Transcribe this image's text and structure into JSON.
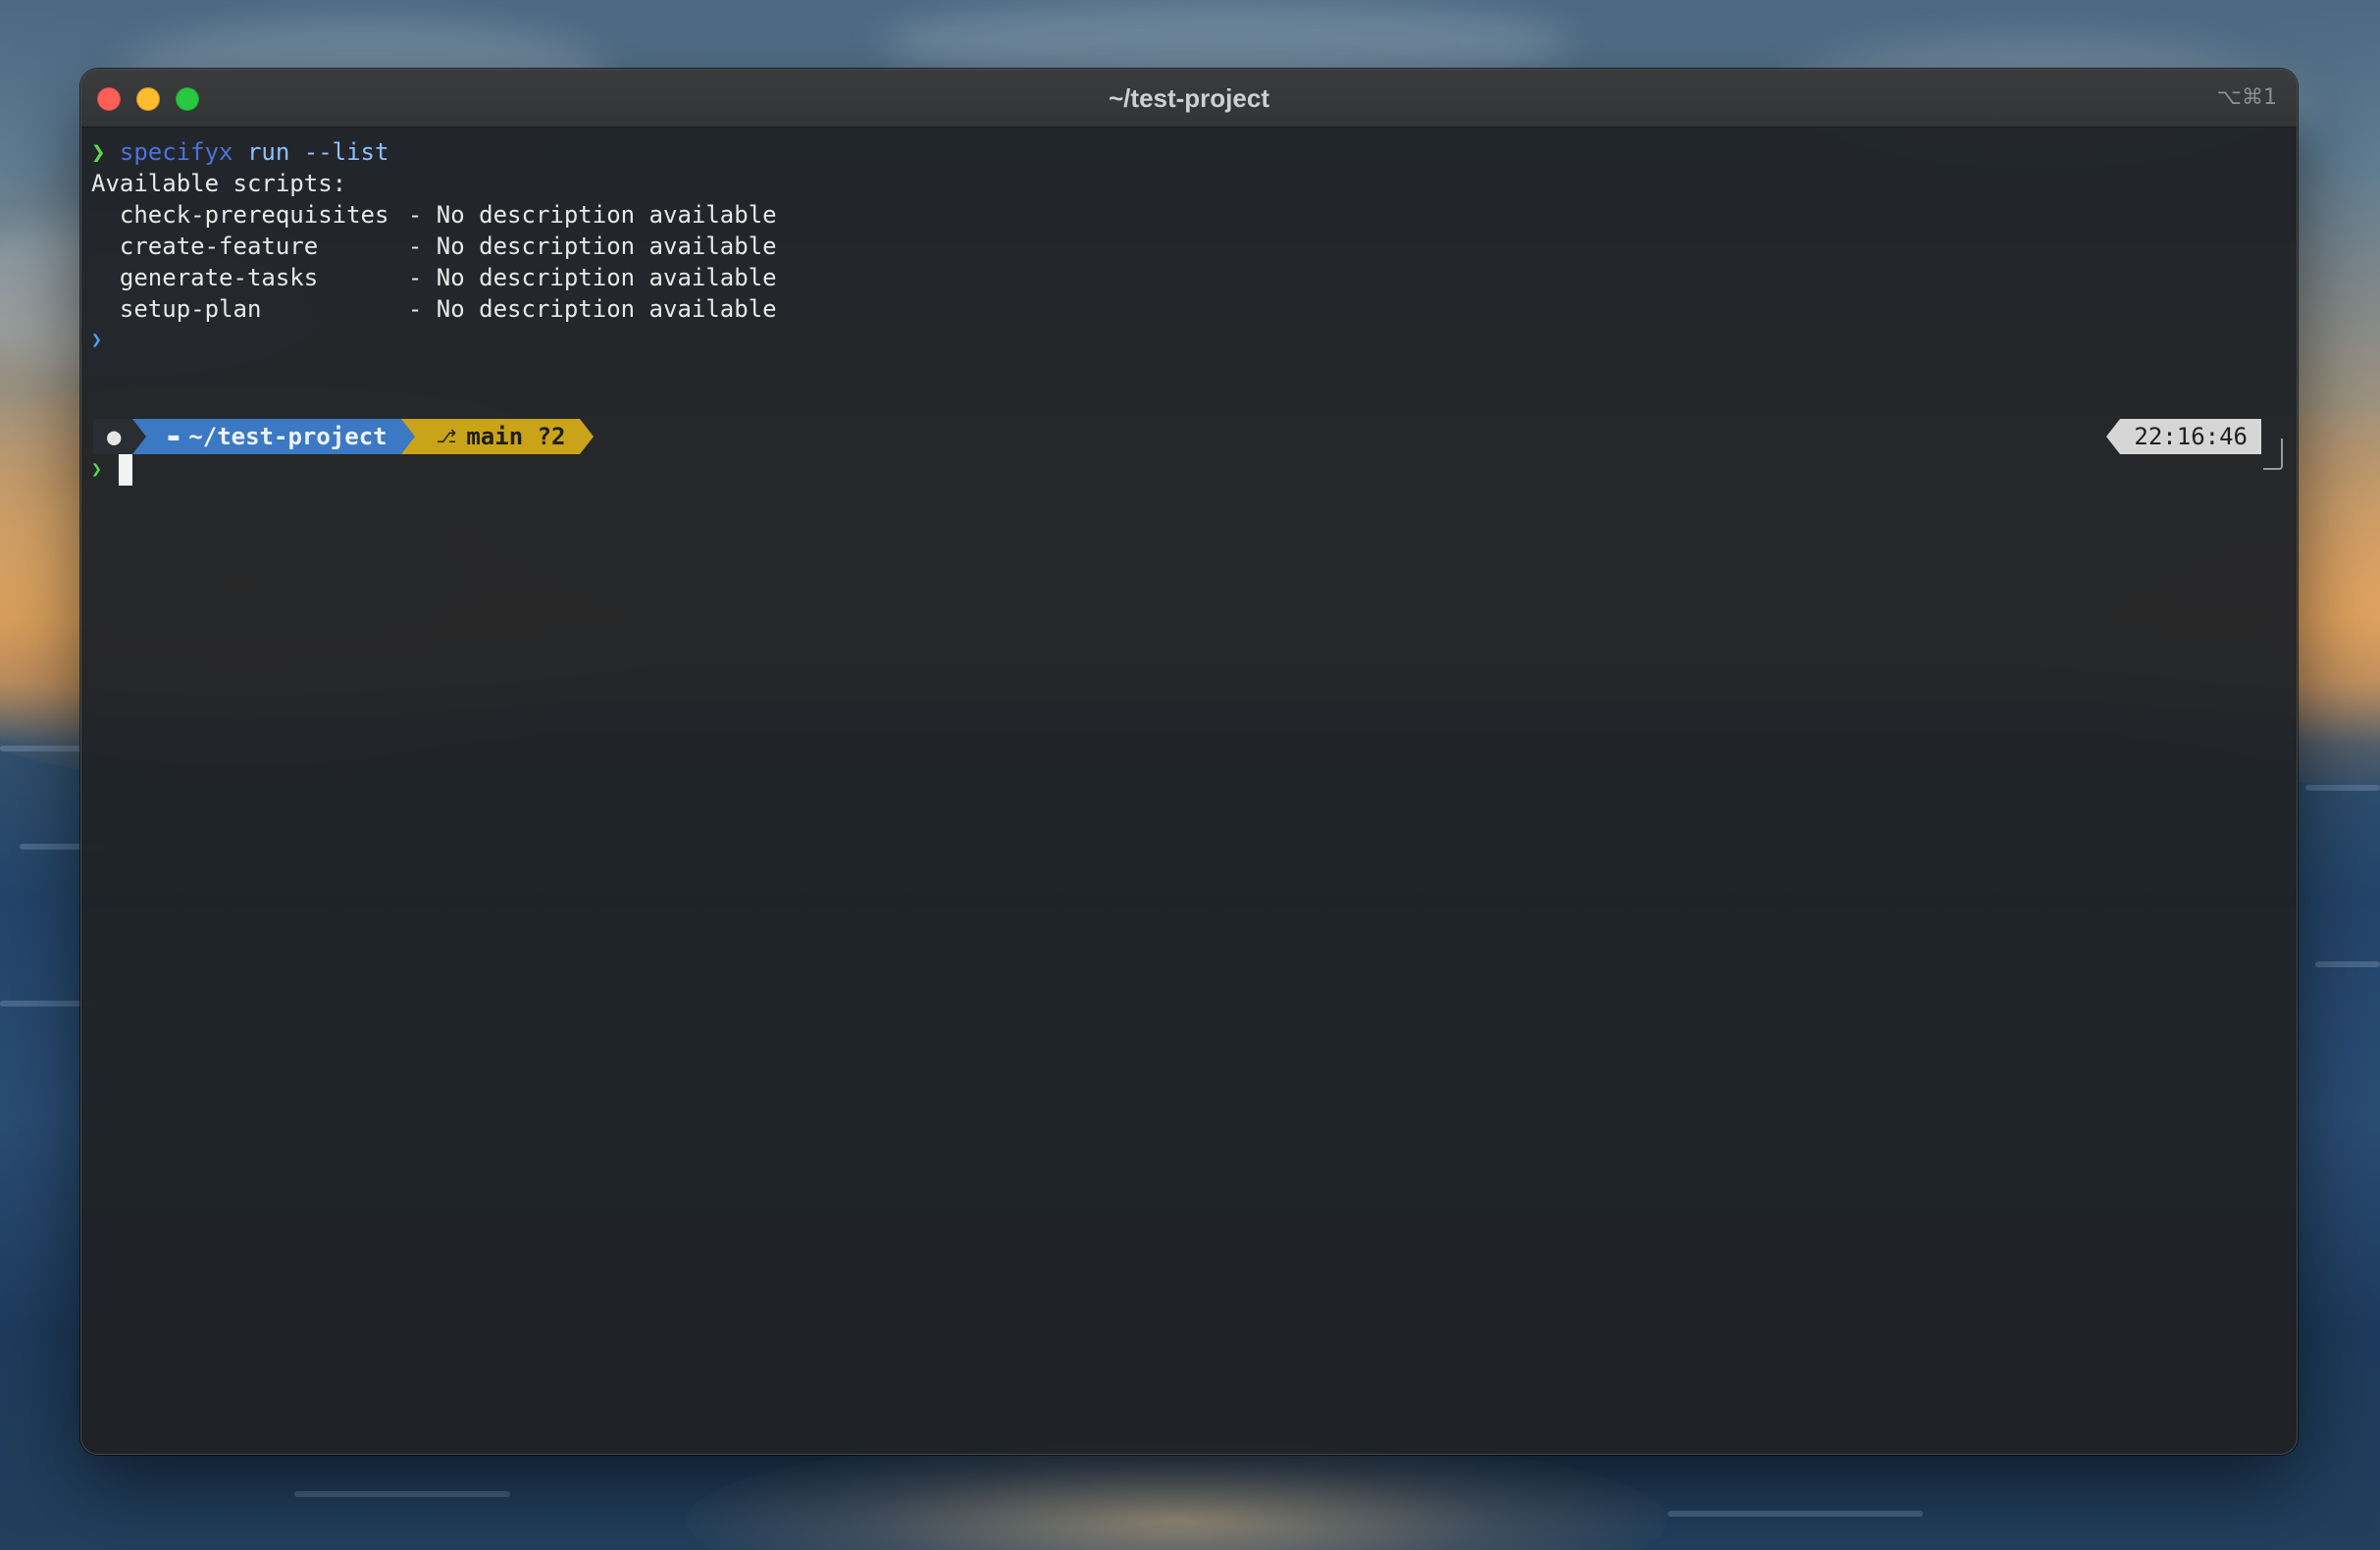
{
  "window": {
    "title": "~/test-project",
    "shortcut": "⌥⌘1"
  },
  "terminal": {
    "command_line": {
      "prompt_glyph": "❯",
      "command": "specifyx",
      "args": "run --list"
    },
    "output_header": "Available scripts:",
    "scripts": [
      {
        "name": "check-prerequisites",
        "description": "- No description available"
      },
      {
        "name": "create-feature",
        "description": "- No description available"
      },
      {
        "name": "generate-tasks",
        "description": "- No description available"
      },
      {
        "name": "setup-plan",
        "description": "- No description available"
      }
    ],
    "empty_prompt_glyph": "❯",
    "powerline": {
      "os_icon": "apple-icon",
      "dir_icon": "folder-icon",
      "directory": "~/test-project",
      "git_icon": "git-branch-icon",
      "git_status": "main ?2",
      "time": "22:16:46"
    },
    "input_prompt_glyph": "❯",
    "input_value": ""
  },
  "colors": {
    "prompt_green": "#5fd74e",
    "command_blue": "#4c73d9",
    "dir_segment": "#3c79c4",
    "git_segment": "#c9a418",
    "time_segment": "#d6d6d6"
  }
}
